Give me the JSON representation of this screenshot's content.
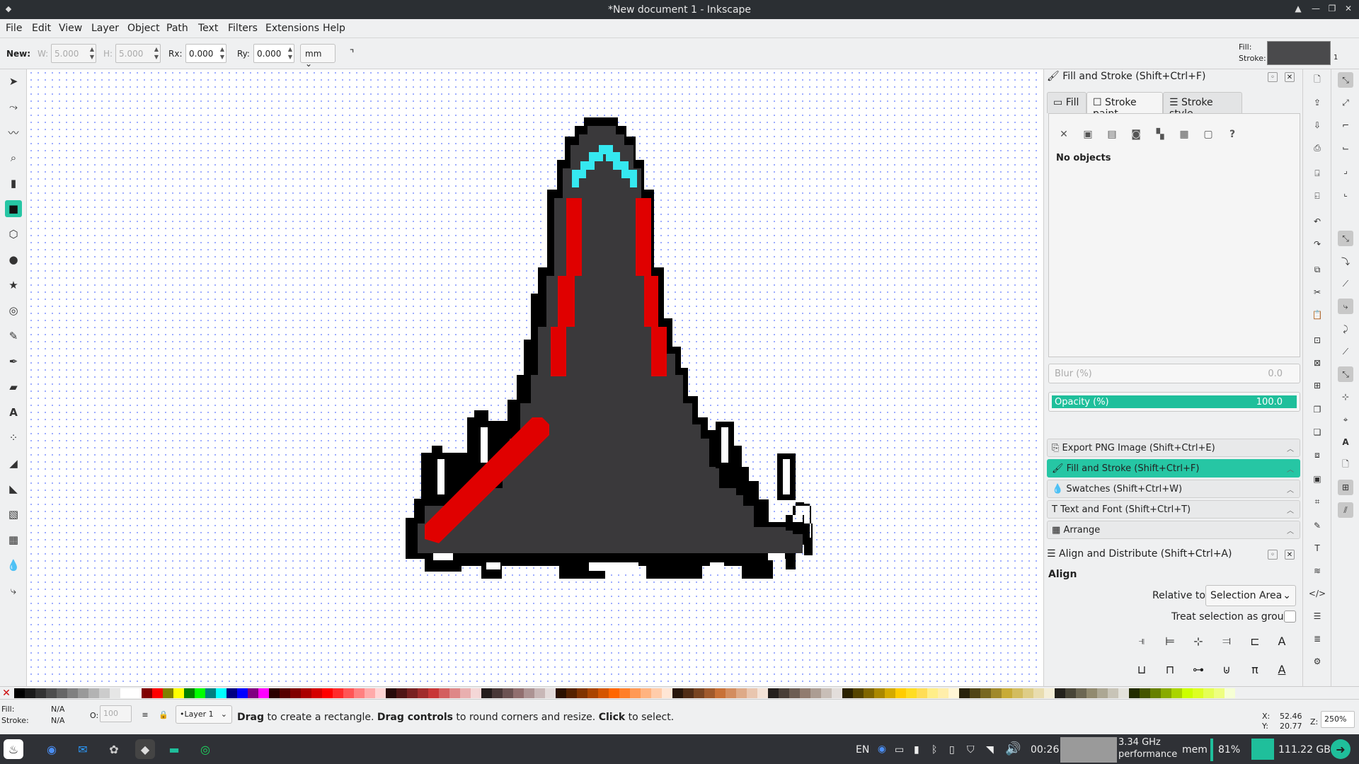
{
  "window": {
    "title": "*New document 1 - Inkscape"
  },
  "menu": [
    "File",
    "Edit",
    "View",
    "Layer",
    "Object",
    "Path",
    "Text",
    "Filters",
    "Extensions",
    "Help"
  ],
  "toolctl": {
    "new_label": "New:",
    "w_label": "W:",
    "w_value": "5.000",
    "h_label": "H:",
    "h_value": "5.000",
    "rx_label": "Rx:",
    "rx_value": "0.000",
    "ry_label": "Ry:",
    "ry_value": "0.000",
    "unit": "mm"
  },
  "fs_indicator": {
    "fill_label": "Fill:",
    "stroke_label": "Stroke:",
    "stroke_width": "1"
  },
  "tools": [
    "selector-icon",
    "node-icon",
    "tweak-icon",
    "zoom-icon",
    "measure-icon",
    "rectangle-icon",
    "box3d-icon",
    "ellipse-icon",
    "star-icon",
    "spiral-icon",
    "pencil-icon",
    "pen-icon",
    "calligraphy-icon",
    "text-icon",
    "spray-icon",
    "eraser-icon",
    "bucket-icon",
    "gradient-icon",
    "mesh-icon",
    "dropper-icon",
    "connector-icon"
  ],
  "fill_stroke": {
    "title": "Fill and Stroke (Shift+Ctrl+F)",
    "tabs": [
      "Fill",
      "Stroke paint",
      "Stroke style"
    ],
    "empty_text": "No objects",
    "blur_label": "Blur (%)",
    "blur_value": "0.0",
    "opacity_label": "Opacity (%)",
    "opacity_value": "100.0",
    "opacity": 1.0
  },
  "docked": [
    {
      "label": "Export PNG Image (Shift+Ctrl+E)",
      "icon": "export-icon"
    },
    {
      "label": "Fill and Stroke (Shift+Ctrl+F)",
      "icon": "brush-icon"
    },
    {
      "label": "Swatches (Shift+Ctrl+W)",
      "icon": "drop-icon"
    },
    {
      "label": "Text and Font (Shift+Ctrl+T)",
      "icon": "text-icon"
    },
    {
      "label": "Arrange",
      "icon": "arrange-icon"
    }
  ],
  "align": {
    "title": "Align and Distribute (Shift+Ctrl+A)",
    "section": "Align",
    "relative_label": "Relative to:",
    "relative_value": "Selection Area",
    "group_label": "Treat selection as group:"
  },
  "status": {
    "fill_label": "Fill:",
    "fill_value": "N/A",
    "stroke_label": "Stroke:",
    "stroke_value": "N/A",
    "opacity_label": "O:",
    "opacity_value": "100",
    "layer": "•Layer 1",
    "msg_b1": "Drag",
    "msg_t1": " to create a rectangle. ",
    "msg_b2": "Drag controls",
    "msg_t2": " to round corners and resize. ",
    "msg_b3": "Click",
    "msg_t3": " to select.",
    "x_label": "X:",
    "x_value": "52.46",
    "y_label": "Y:",
    "y_value": "20.77",
    "z_label": "Z:",
    "zoom": "250%"
  },
  "taskbar": {
    "lang": "EN",
    "time": "00:26",
    "cpu_freq": "3.34 GHz",
    "cpu_mode": "performance",
    "mem_label": "mem",
    "mem_pct": "81%",
    "disk": "111.22 GB"
  },
  "colors": {
    "accent": "#26c6a4",
    "ship_body": "#3a393b",
    "ship_red": "#e00000",
    "ship_cyan": "#35e8f0"
  }
}
